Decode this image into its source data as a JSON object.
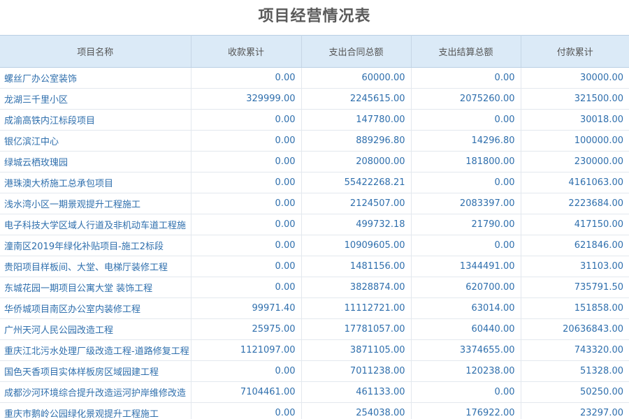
{
  "title": "项目经营情况表",
  "table": {
    "headers": [
      "项目名称",
      "收款累计",
      "支出合同总额",
      "支出结算总额",
      "付款累计"
    ],
    "rows": [
      [
        "螺丝厂办公室装饰",
        "0.00",
        "60000.00",
        "0.00",
        "30000.00"
      ],
      [
        "龙湖三千里小区",
        "329999.00",
        "2245615.00",
        "2075260.00",
        "321500.00"
      ],
      [
        "成渝高铁内江标段项目",
        "0.00",
        "147780.00",
        "0.00",
        "30018.00"
      ],
      [
        "银亿滨江中心",
        "0.00",
        "889296.80",
        "14296.80",
        "100000.00"
      ],
      [
        "绿城云栖玫瑰园",
        "0.00",
        "208000.00",
        "181800.00",
        "230000.00"
      ],
      [
        "港珠澳大桥施工总承包项目",
        "0.00",
        "55422268.21",
        "0.00",
        "4161063.00"
      ],
      [
        "浅水湾小区一期景观提升工程施工",
        "0.00",
        "2124507.00",
        "2083397.00",
        "2223684.00"
      ],
      [
        "电子科技大学区域人行道及非机动车道工程施",
        "0.00",
        "499732.18",
        "21790.00",
        "417150.00"
      ],
      [
        "潼南区2019年绿化补贴项目-施工2标段",
        "0.00",
        "10909605.00",
        "0.00",
        "621846.00"
      ],
      [
        "贵阳项目样板间、大堂、电梯厅装修工程",
        "0.00",
        "1481156.00",
        "1344491.00",
        "31103.00"
      ],
      [
        "东城花园一期项目公寓大堂 装饰工程",
        "0.00",
        "3828874.00",
        "620700.00",
        "735791.50"
      ],
      [
        "华侨城项目南区办公室内装修工程",
        "99971.40",
        "11112721.00",
        "63014.00",
        "151858.00"
      ],
      [
        "广州天河人民公园改造工程",
        "25975.00",
        "17781057.00",
        "60440.00",
        "20636843.00"
      ],
      [
        "重庆江北污水处理厂级改造工程-道路修复工程",
        "1121097.00",
        "3871105.00",
        "3374655.00",
        "743320.00"
      ],
      [
        "国色天香项目实体样板房区域园建工程",
        "0.00",
        "7011238.00",
        "120238.00",
        "51328.00"
      ],
      [
        "成都沙河环境综合提升改造运河护岸维修改造",
        "7104461.00",
        "461133.00",
        "0.00",
        "50250.00"
      ],
      [
        "重庆市鹅岭公园绿化景观提升工程施工",
        "0.00",
        "254038.00",
        "176922.00",
        "23297.00"
      ]
    ]
  }
}
